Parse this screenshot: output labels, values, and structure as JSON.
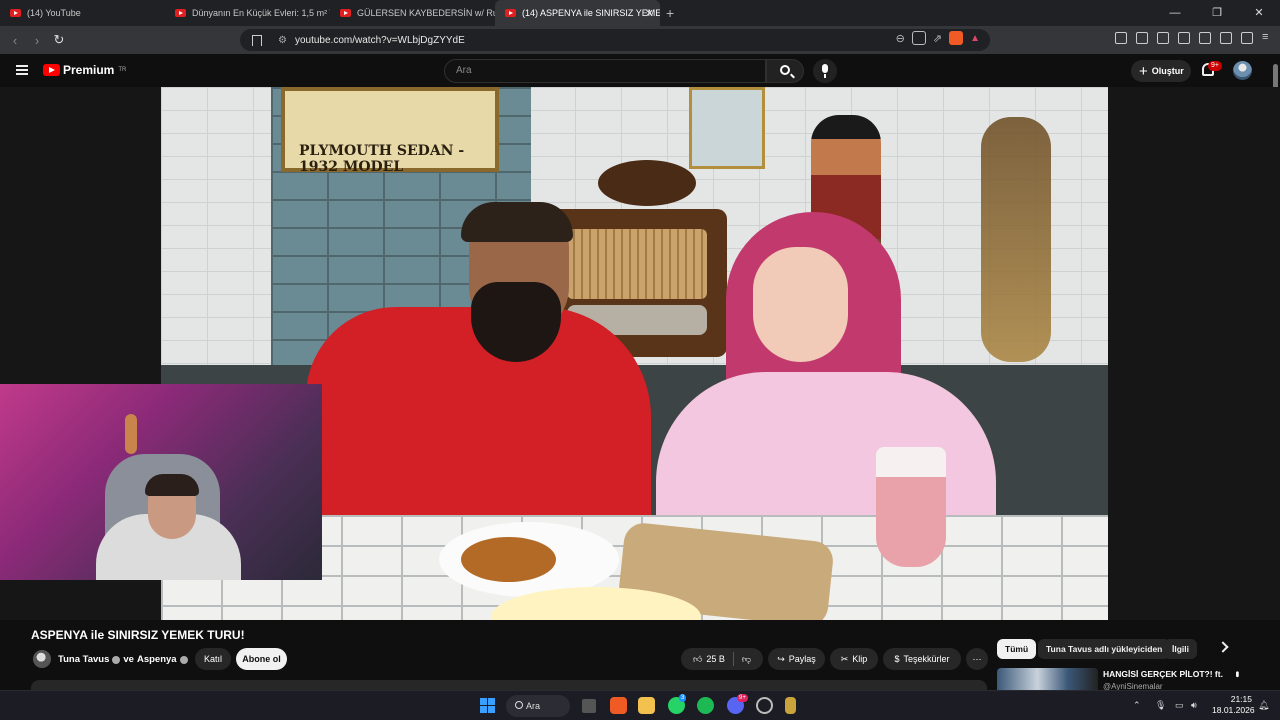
{
  "browser": {
    "tabs": [
      {
        "label": "(14) YouTube"
      },
      {
        "label": "Dünyanın En Küçük Evleri: 1,5 m² Tab"
      },
      {
        "label": "GÜLERSEN KAYBEDERSİN w/ Rutin D"
      },
      {
        "label": "(14) ASPENYA ile SINIRSIZ YEMEK",
        "active": true
      }
    ],
    "new_tab": "+",
    "url": "youtube.com/watch?v=WLbjDgZYYdE"
  },
  "youtube": {
    "logo_text": "Premium",
    "logo_region": "TR",
    "search_placeholder": "Ara",
    "create_label": "Oluştur",
    "notification_count": "9+"
  },
  "video": {
    "sign_text": "PLYMOUTH SEDAN - 1932 MODEL",
    "title": "ASPENYA ile SINIRSIZ YEMEK TURU!",
    "channel": "Tuna Tavus",
    "channel_joiner": "ve",
    "collab_channel": "Aspenya",
    "join_label": "Katıl",
    "subscribe_label": "Abone ol",
    "like_count": "25 B",
    "share_label": "Paylaş",
    "clip_label": "Klip",
    "thanks_label": "Teşekkürler"
  },
  "sidebar": {
    "chips": [
      "Tümü",
      "Tuna Tavus adlı yükleyiciden",
      "İlgili"
    ],
    "rec_title": "HANGİSİ GERÇEK PİLOT?! ft.",
    "rec_channel": "@AyniSinemalar"
  },
  "taskbar": {
    "search_label": "Ara",
    "whatsapp_badge": "3",
    "discord_badge": "9+",
    "time": "21:15",
    "date": "18.01.2026"
  },
  "colors": {
    "brand_red": "#ff0000",
    "background": "#0f0f0f",
    "chip_dark": "#272727"
  },
  "icons": [
    "menu-icon",
    "search-icon",
    "mic-icon",
    "bell-icon",
    "like-icon",
    "dislike-icon",
    "share-icon",
    "clip-icon",
    "thanks-icon",
    "more-icon",
    "chevron-right-icon",
    "windows-icon"
  ]
}
